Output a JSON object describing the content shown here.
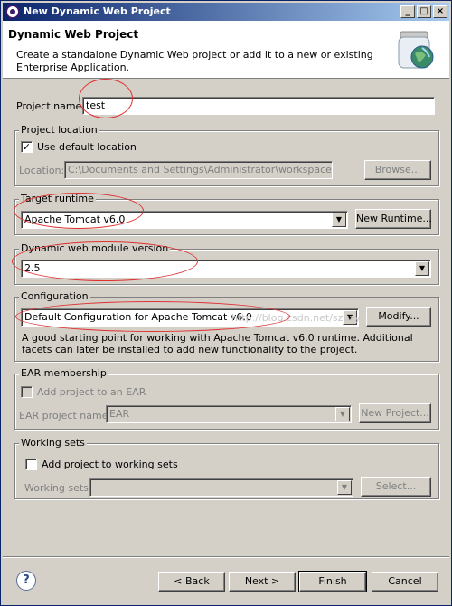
{
  "window": {
    "title": "New Dynamic Web Project",
    "controls": {
      "minimize": "_",
      "maximize": "□",
      "close": "×"
    }
  },
  "header": {
    "title": "Dynamic Web Project",
    "description": "Create a standalone Dynamic Web project or add it to a new or existing Enterprise Application.",
    "art_icon": "jar-globe-icon"
  },
  "project_name": {
    "label": "Project name:",
    "value": "test"
  },
  "project_location": {
    "group_title": "Project location",
    "use_default_label": "Use default location",
    "use_default_checked": true,
    "location_label": "Location:",
    "location_value": "C:\\Documents and Settings\\Administrator\\workspace\\test",
    "browse_label": "Browse..."
  },
  "target_runtime": {
    "group_title": "Target runtime",
    "selected": "Apache Tomcat v6.0",
    "new_runtime_label": "New Runtime..."
  },
  "web_module": {
    "group_title": "Dynamic web module version",
    "selected": "2.5"
  },
  "configuration": {
    "group_title": "Configuration",
    "selected": "Default Configuration for Apache Tomcat v6.0",
    "watermark": "http://blog.csdn.net/szuzy",
    "modify_label": "Modify...",
    "description": "A good starting point for working with Apache Tomcat v6.0 runtime. Additional facets can later be installed to add new functionality to the project."
  },
  "ear_membership": {
    "group_title": "EAR membership",
    "add_label": "Add project to an EAR",
    "add_checked": false,
    "project_name_label": "EAR project name:",
    "project_name_value": "EAR",
    "new_project_label": "New Project..."
  },
  "working_sets": {
    "group_title": "Working sets",
    "add_label": "Add project to working sets",
    "add_checked": false,
    "sets_label": "Working sets:",
    "sets_value": "",
    "select_label": "Select..."
  },
  "footer": {
    "help_icon": "help-icon",
    "help_glyph": "?",
    "back_label": "< Back",
    "next_label": "Next >",
    "finish_label": "Finish",
    "cancel_label": "Cancel"
  },
  "colors": {
    "annotation_circle": "#e03030",
    "titlebar_start": "#0a246a",
    "titlebar_end": "#a6caf0",
    "dialog_bg": "#d4d0c8"
  }
}
